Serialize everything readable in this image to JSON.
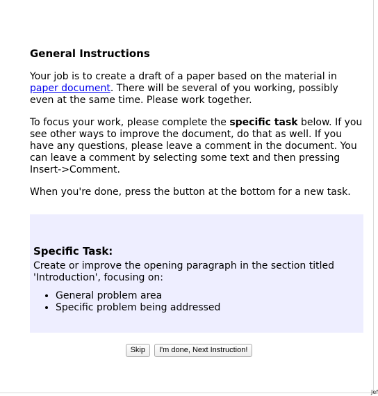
{
  "general": {
    "heading": "General Instructions",
    "p1_before": "Your job is to create a draft of a paper based on the material in ",
    "p1_link": "paper document",
    "p1_after": ". There will be several of you working, possibly even at the same time. Please work together.",
    "p2_before": "To focus your work, please complete the ",
    "p2_bold": "specific task",
    "p2_after": " below. If you see other ways to improve the document, do that as well. If you have any questions, please leave a comment in the document. You can leave a comment by selecting some text and then pressing Insert->Comment.",
    "p3": "When you're done, press the button at the bottom for a new task."
  },
  "task": {
    "heading": "Specific Task:",
    "description": "Create or improve the opening paragraph in the section titled 'Introduction', focusing on:",
    "items": [
      "General problem area",
      "Specific problem being addressed"
    ]
  },
  "buttons": {
    "skip_label": "Skip",
    "next_label": "I'm done, Next Instruction!"
  },
  "corner": {
    "text": "Jef"
  },
  "colors": {
    "task_background": "#eeeeff",
    "link": "#0000ee"
  }
}
